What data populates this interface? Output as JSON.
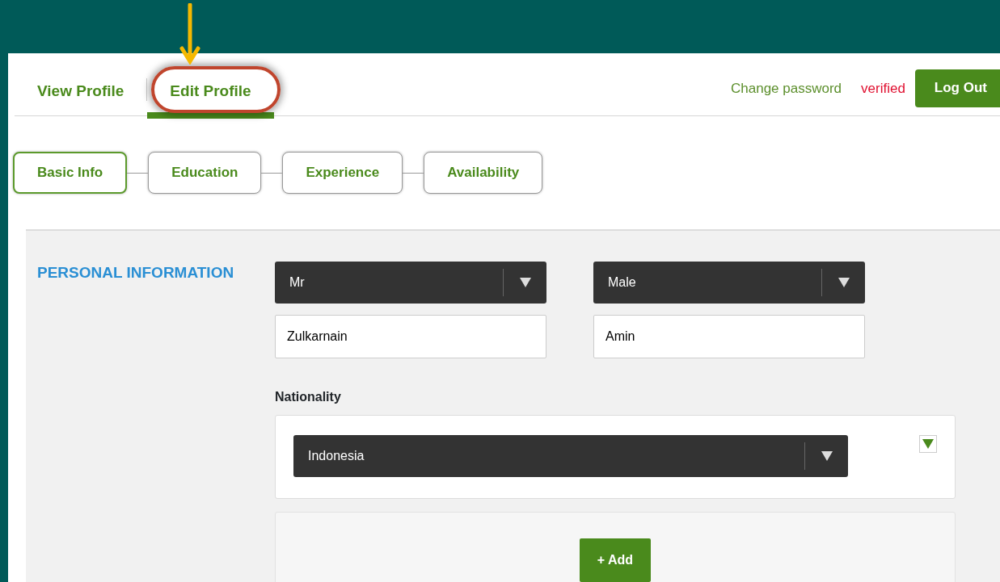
{
  "tabs": [
    {
      "label": "View Profile",
      "selected": false
    },
    {
      "label": "Edit Profile",
      "selected": true
    }
  ],
  "account_links": {
    "change_password": "Change password",
    "status": "verified",
    "logout": "Log Out"
  },
  "steps": [
    {
      "label": "Basic Info",
      "selected": true
    },
    {
      "label": "Education",
      "selected": false
    },
    {
      "label": "Experience",
      "selected": false
    },
    {
      "label": "Availability",
      "selected": false
    }
  ],
  "section": {
    "title": "PERSONAL INFORMATION",
    "selects": [
      {
        "value": "Mr"
      },
      {
        "value": "Male"
      }
    ],
    "inputs": [
      {
        "value": "Zulkarnain"
      },
      {
        "value": "Amin"
      }
    ],
    "nationality": {
      "label": "Nationality",
      "value": "Indonesia"
    },
    "add_button": "+ Add"
  }
}
